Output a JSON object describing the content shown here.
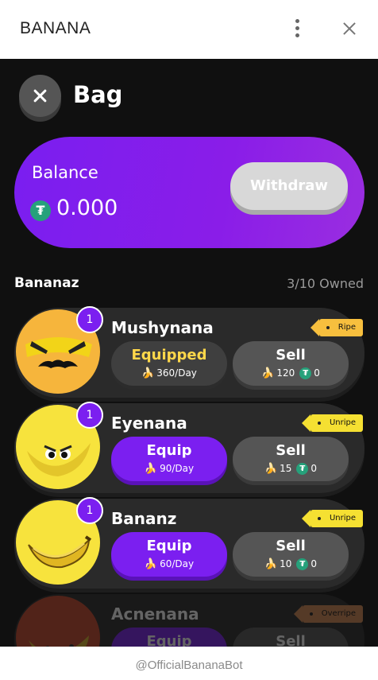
{
  "app": {
    "title": "BANANA"
  },
  "screen": {
    "title": "Bag"
  },
  "balance": {
    "label": "Balance",
    "currency_icon": "usdt-icon",
    "value": "0.000",
    "withdraw_label": "Withdraw"
  },
  "bananaz": {
    "title": "Bananaz",
    "owned": "3/10 Owned",
    "items": [
      {
        "name": "Mushynana",
        "qty": "1",
        "tag": "Ripe",
        "action": "Equipped",
        "rate": "360/Day",
        "sell_label": "Sell",
        "sell_bananas": "120",
        "sell_usdt": "0"
      },
      {
        "name": "Eyenana",
        "qty": "1",
        "tag": "Unripe",
        "action": "Equip",
        "rate": "90/Day",
        "sell_label": "Sell",
        "sell_bananas": "15",
        "sell_usdt": "0"
      },
      {
        "name": "Bananz",
        "qty": "1",
        "tag": "Unripe",
        "action": "Equip",
        "rate": "60/Day",
        "sell_label": "Sell",
        "sell_bananas": "10",
        "sell_usdt": "0"
      },
      {
        "name": "Acnenana",
        "tag": "Overripe",
        "action": "Equip",
        "sell_label": "Sell"
      }
    ]
  },
  "footer": {
    "text": "@OfficialBananaBot"
  },
  "colors": {
    "accent": "#7b1ff0",
    "usdt": "#26a17b",
    "banana": "#ffd440",
    "equipped_text": "#ffd84a"
  }
}
